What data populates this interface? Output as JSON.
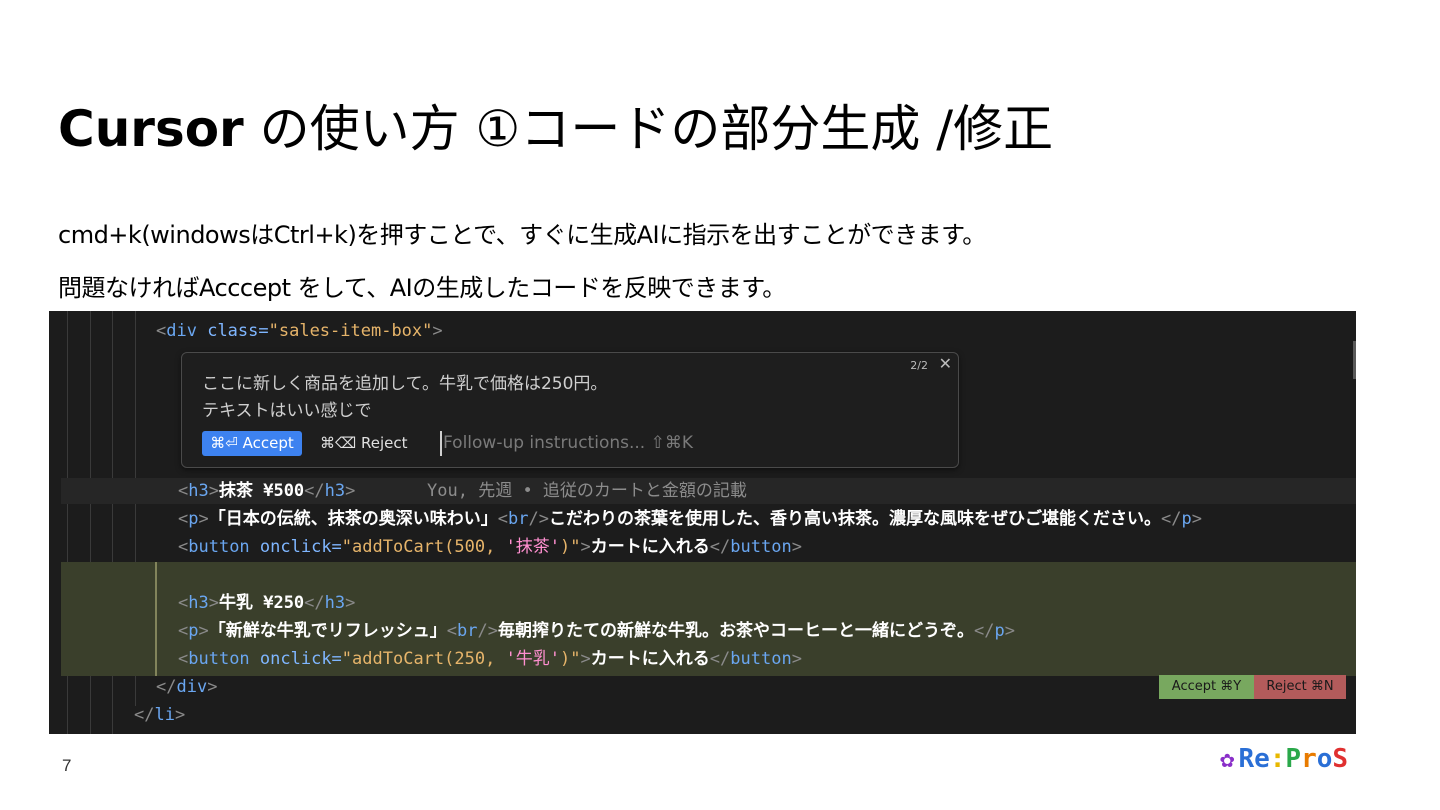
{
  "slide": {
    "title_brand": "Cursor",
    "title_rest": " の使い方 ①コードの部分生成 /修正",
    "line1": "cmd+k(windowsはCtrl+k)を押すことで、すぐに生成AIに指示を出すことができます。",
    "line2": "問題なければAcccept をして、AIの生成したコードを反映できます。",
    "page_number": "7",
    "logo_text": "Re:ProS"
  },
  "editor": {
    "line_div_open": {
      "lt": "<",
      "tag": "div",
      "attr": " class=",
      "value": "\"sales-item-box\"",
      "gt": ">"
    },
    "popup": {
      "prompt_line1": "ここに新しく商品を追加して。牛乳で価格は250円。",
      "prompt_line2": "テキストはいい感じで",
      "count": "2/2",
      "close": "✕",
      "accept_label": "⌘⏎ Accept",
      "reject_label": "⌘⌫ Reject",
      "followup_placeholder": "Follow-up instructions... ⇧⌘K"
    },
    "h3_matcha": "抹茶 ¥500",
    "blame": "You, 先週 • 追従のカートと金額の記載",
    "p_matcha_1": "「日本の伝統、抹茶の奥深い味わい」",
    "p_matcha_2": "こだわりの茶葉を使用した、香り高い抹茶。濃厚な風味をぜひご堪能ください。",
    "btn_matcha_call": "\"addToCart(500, ",
    "btn_matcha_arg": "'抹茶'",
    "btn_call_end": ")\"",
    "btn_text": "カートに入れる",
    "h3_milk": "牛乳 ¥250",
    "p_milk_1": "「新鮮な牛乳でリフレッシュ」",
    "p_milk_2": "毎朝搾りたての新鮮な牛乳。お茶やコーヒーと一緒にどうぞ。",
    "btn_milk_call": "\"addToCart(250, ",
    "btn_milk_arg": "'牛乳'",
    "accept_badge": "Accept ⌘Y",
    "reject_badge": "Reject ⌘N"
  }
}
